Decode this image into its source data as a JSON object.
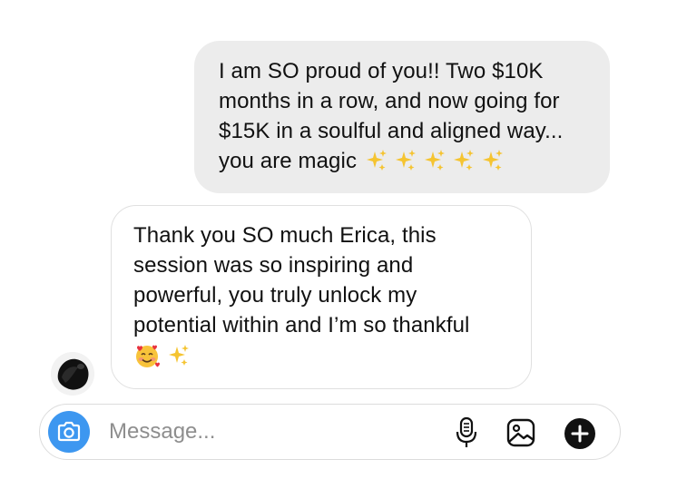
{
  "conversation": {
    "outgoing_message": {
      "lines": [
        "I am SO proud of you!! Two $10K",
        "months in a row, and now going for",
        "$15K in a soulful and aligned way...",
        "you are magic"
      ],
      "emojis": [
        "sparkles",
        "sparkles",
        "sparkles",
        "sparkles",
        "sparkles"
      ]
    },
    "incoming_message": {
      "lines": [
        "Thank you SO much Erica, this",
        "session was so inspiring and",
        "powerful, you truly unlock my",
        "potential within and I’m so thankful"
      ],
      "emojis": [
        "smiling-face-with-hearts",
        "sparkles"
      ]
    }
  },
  "composer": {
    "placeholder": "Message...",
    "icons": [
      "camera-icon",
      "microphone-icon",
      "gallery-icon",
      "plus-icon"
    ],
    "accent_color": "#3d97f0"
  }
}
